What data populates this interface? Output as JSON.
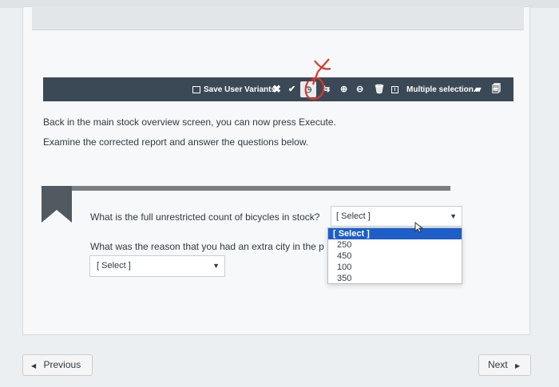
{
  "toolbar": {
    "save_variants_label": "Save User Variants",
    "multiple_selection_label": "Multiple selection..."
  },
  "instructions": {
    "line1": "Back in the main stock overview screen, you can now press Execute.",
    "line2": "Examine the corrected report and answer the questions below."
  },
  "question1": {
    "text": "What is the full unrestricted count of bicycles in stock?",
    "select_value": "[ Select ]"
  },
  "dropdown": {
    "options": [
      "[ Select ]",
      "250",
      "450",
      "100",
      "350"
    ],
    "selected_index": 0
  },
  "question2": {
    "text": "What was the reason that you had an extra city in the p",
    "select_value": "[ Select ]"
  },
  "navigation": {
    "previous_label": "Previous",
    "next_label": "Next"
  },
  "colors": {
    "toolbar_bg": "#3b4856",
    "dropdown_highlight": "#1d5ec9",
    "annotation_red": "#d43a2a"
  }
}
